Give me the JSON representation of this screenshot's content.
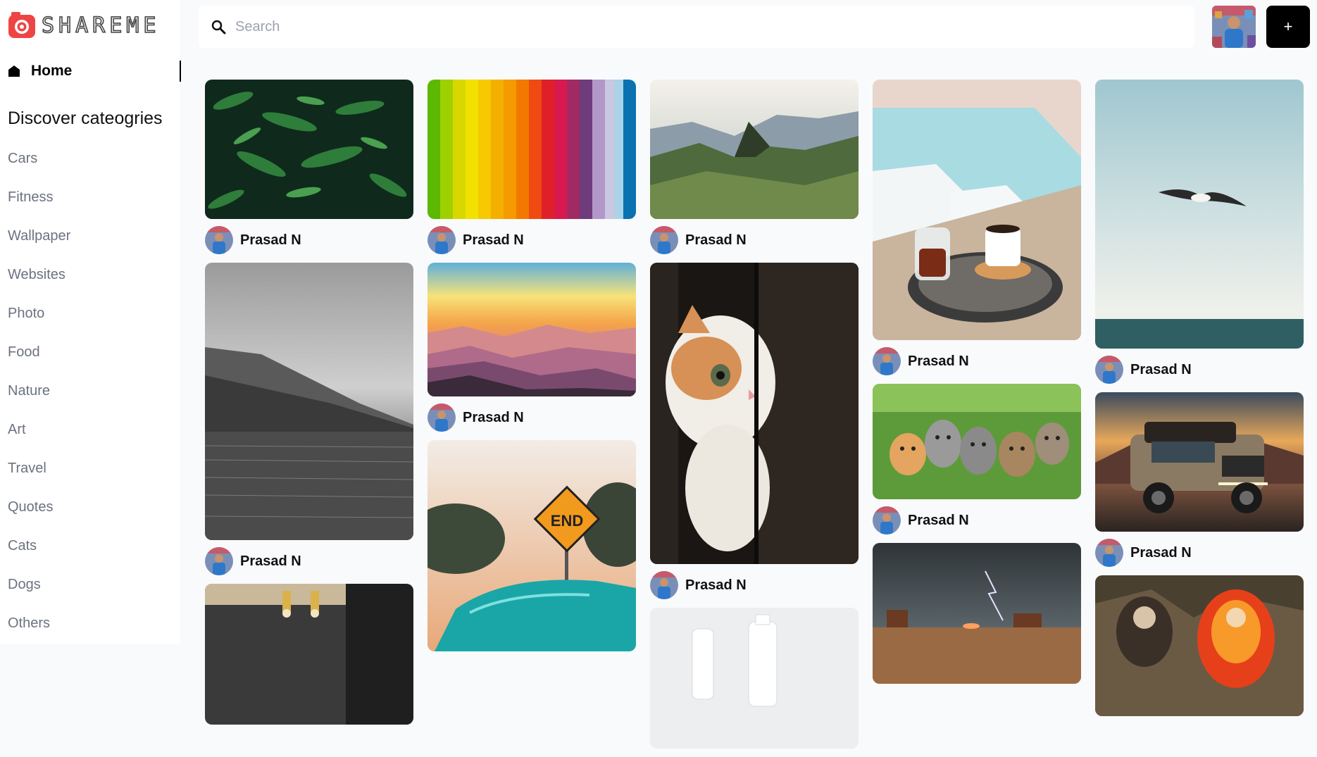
{
  "app": {
    "name": "SHAREME",
    "brand_color": "#ef4444"
  },
  "nav": {
    "home_label": "Home",
    "home_icon": "home-icon"
  },
  "sidebar": {
    "heading": "Discover cateogries",
    "categories": [
      "Cars",
      "Fitness",
      "Wallpaper",
      "Websites",
      "Photo",
      "Food",
      "Nature",
      "Art",
      "Travel",
      "Quotes",
      "Cats",
      "Dogs",
      "Others"
    ]
  },
  "search": {
    "placeholder": "Search",
    "value": ""
  },
  "header": {
    "add_button_label": "+"
  },
  "pins": {
    "author": "Prasad N",
    "images": [
      "pine-branches",
      "rainbow-stripes",
      "mountain-ruins",
      "pool-tea-tray",
      "seagull-sea",
      "grey-lake",
      "pastel-mountains",
      "kitten-peeking",
      "kittens-grass",
      "offroad-truck",
      "workshop",
      "end-sign-car",
      "bottles",
      "desert-storm",
      "anime-art"
    ]
  }
}
